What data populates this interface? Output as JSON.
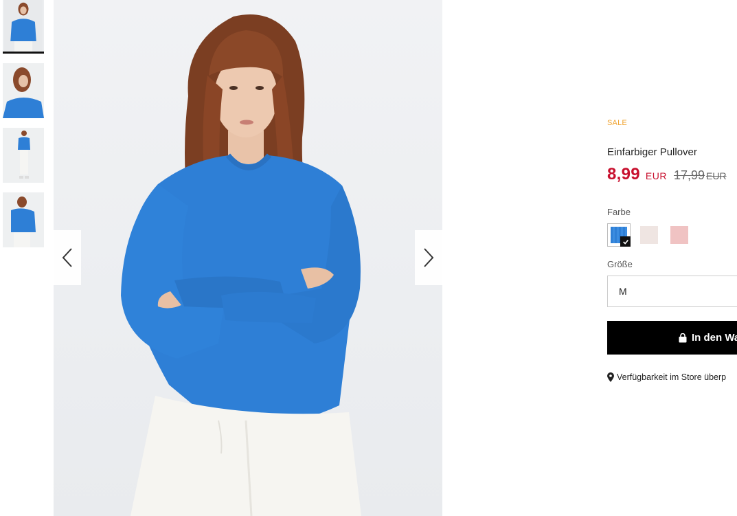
{
  "product": {
    "badge": "SALE",
    "title": "Einfarbiger Pullover",
    "price_now": "8,99",
    "currency_now": "EUR",
    "price_old": "17,99",
    "currency_old": "EUR"
  },
  "options": {
    "color_label": "Farbe",
    "size_label": "Größe",
    "size_value": "M",
    "colors": [
      {
        "name": "blue",
        "hex": "#2e7fd6",
        "selected": true
      },
      {
        "name": "light-beige",
        "hex": "#efe5e2",
        "selected": false
      },
      {
        "name": "pink",
        "hex": "#f0c3c3",
        "selected": false
      }
    ]
  },
  "actions": {
    "add_to_cart": "In den Wa",
    "store_availability": "Verfügbarkeit im Store überp"
  },
  "icons": {
    "prev": "chevron-left-icon",
    "next": "chevron-right-icon",
    "bag": "shopping-bag-icon",
    "pin": "map-pin-icon",
    "check": "check-icon"
  },
  "colors": {
    "sweater_blue": "#2e7fd6",
    "sale_orange": "#f0a431",
    "price_red": "#c8102e"
  }
}
